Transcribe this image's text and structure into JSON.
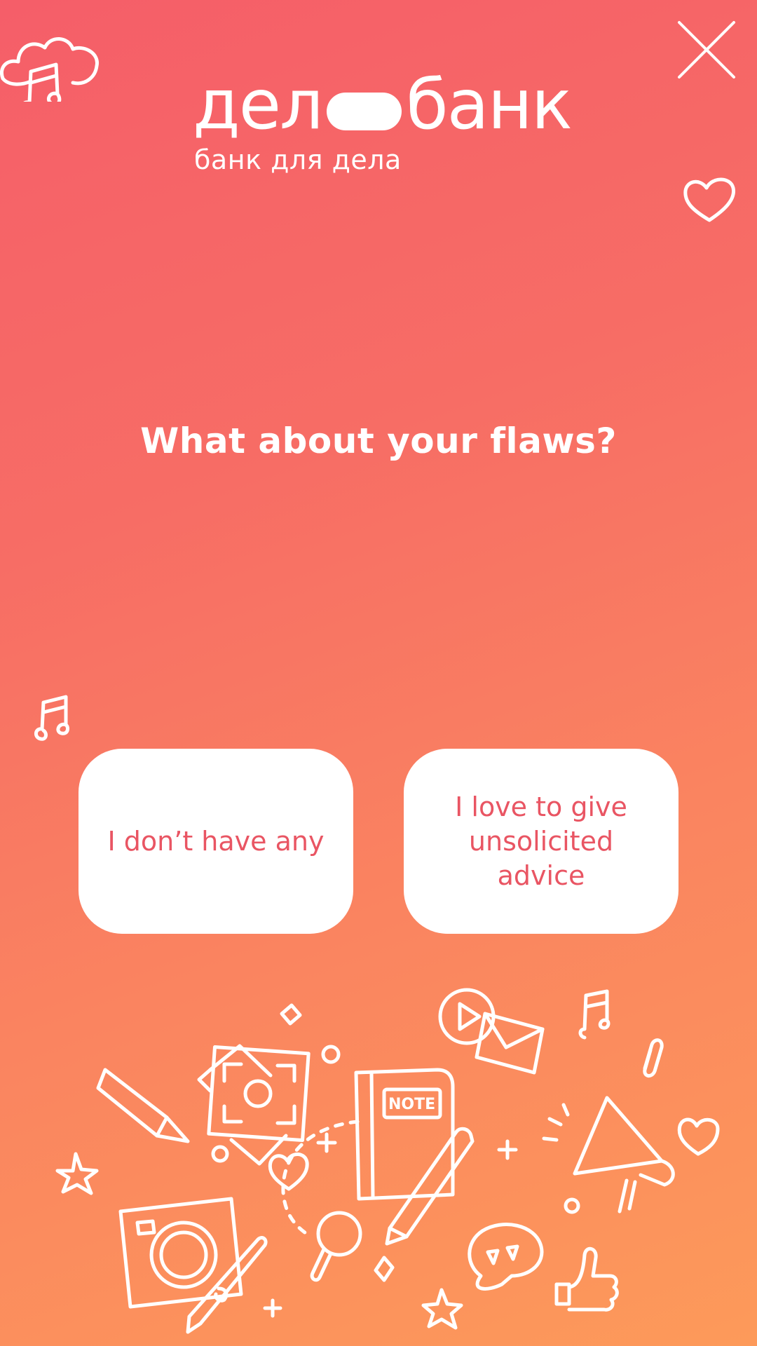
{
  "logo": {
    "left_text": "дел",
    "right_text": "банк",
    "tagline": "банк для дела"
  },
  "question": {
    "text": "What about your flaws?"
  },
  "answers": [
    {
      "label": "I don’t have any"
    },
    {
      "label": "I love to give unsolicited advice"
    }
  ],
  "doodles": {
    "note_label": "NOTE"
  },
  "colors": {
    "gradient_top": "#f55e69",
    "gradient_bottom": "#fd9a5a",
    "button_bg": "#ffffff",
    "button_text": "#e95563"
  },
  "icons": {
    "close": "close-icon",
    "cloud_music": "cloud-music-icon",
    "heart": "heart-icon",
    "music_note": "music-note-icon"
  }
}
